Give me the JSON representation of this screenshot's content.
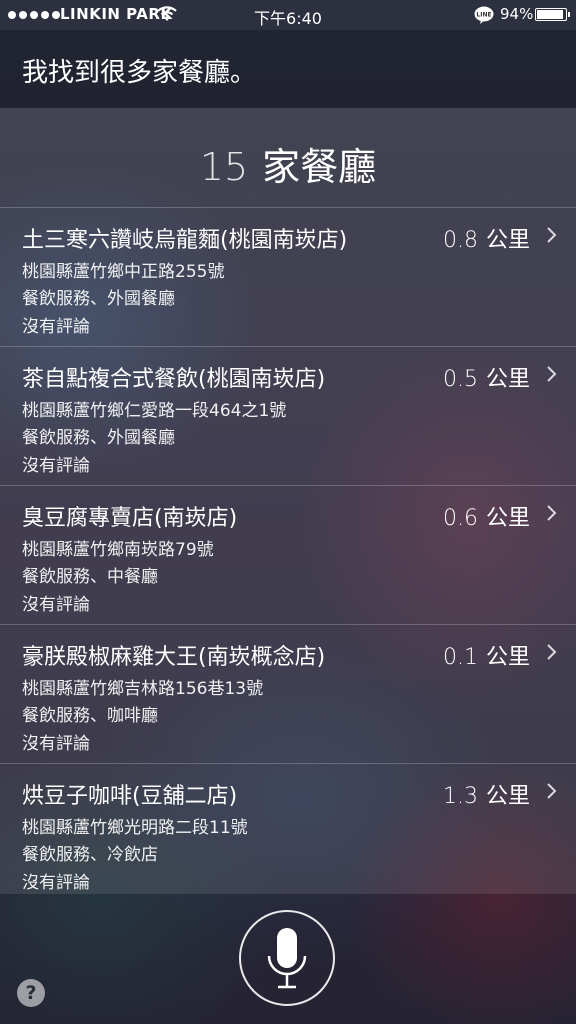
{
  "status_bar": {
    "carrier": "LINKIN PARK",
    "time": "下午6:40",
    "battery": "94%",
    "battery_level": 0.94,
    "signal_bars": 5
  },
  "siri": {
    "response": "我找到很多家餐廳。"
  },
  "results": {
    "count": "15",
    "title": "家餐廳",
    "unit": "公里",
    "items": [
      {
        "name": "土三寒六讚岐烏龍麵(桃園南崁店)",
        "distance": "0.8",
        "address": "桃園縣蘆竹鄉中正路255號",
        "category": "餐飲服務、外國餐廳",
        "review": "沒有評論"
      },
      {
        "name": "茶自點複合式餐飲(桃園南崁店)",
        "distance": "0.5",
        "address": "桃園縣蘆竹鄉仁愛路一段464之1號",
        "category": "餐飲服務、外國餐廳",
        "review": "沒有評論"
      },
      {
        "name": "臭豆腐專賣店(南崁店)",
        "distance": "0.6",
        "address": "桃園縣蘆竹鄉南崁路79號",
        "category": "餐飲服務、中餐廳",
        "review": "沒有評論"
      },
      {
        "name": "豪朕殿椒麻雞大王(南崁概念店)",
        "distance": "0.1",
        "address": "桃園縣蘆竹鄉吉林路156巷13號",
        "category": "餐飲服務、咖啡廳",
        "review": "沒有評論"
      },
      {
        "name": "烘豆子咖啡(豆舖二店)",
        "distance": "1.3",
        "address": "桃園縣蘆竹鄉光明路二段11號",
        "category": "餐飲服務、冷飲店",
        "review": "沒有評論"
      }
    ]
  },
  "controls": {
    "help_label": "?"
  },
  "icons": {
    "wifi": "wifi-icon",
    "line": "line-app-icon",
    "chevron": "chevron-right-icon",
    "mic": "microphone-icon"
  }
}
